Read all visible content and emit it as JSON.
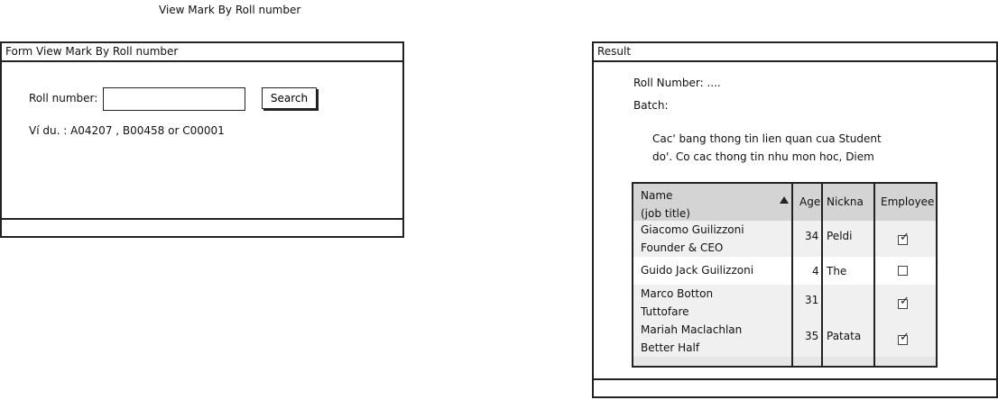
{
  "page_title": "View Mark By Roll number",
  "form_window": {
    "title": "Form View Mark By Roll number",
    "roll_label": "Roll number:",
    "roll_value": "",
    "search_label": "Search",
    "example_text": "Ví du. : A04207 , B00458 or C00001"
  },
  "result_window": {
    "title": "Result",
    "roll_number_text": "Roll Number: ....",
    "batch_text": "Batch:",
    "description_line1": "Cac' bang thong tin lien quan cua Student",
    "description_line2": "do'. Co cac thong tin nhu mon hoc, Diem",
    "table": {
      "headers": {
        "name_line1": "Name",
        "name_line2": "(job title)",
        "age": "Age",
        "nickname": "Nickna",
        "employee": "Employee"
      },
      "rows": [
        {
          "name": "Giacomo Guilizzoni",
          "title": "Founder & CEO",
          "age": "34",
          "nickname": "Peldi",
          "employee": true
        },
        {
          "name": "Guido Jack Guilizzoni",
          "title": "",
          "age": "4",
          "nickname": "The",
          "employee": false
        },
        {
          "name": "Marco Botton",
          "title": "Tuttofare",
          "age": "31",
          "nickname": "",
          "employee": true
        },
        {
          "name": "Mariah Maclachlan",
          "title": "Better Half",
          "age": "35",
          "nickname": "Patata",
          "employee": true
        }
      ]
    }
  },
  "icons": {
    "sort": "sort-ascending-icon",
    "checkbox_checked": "checkbox-checked-icon",
    "checkbox_empty": "checkbox-empty-icon"
  }
}
